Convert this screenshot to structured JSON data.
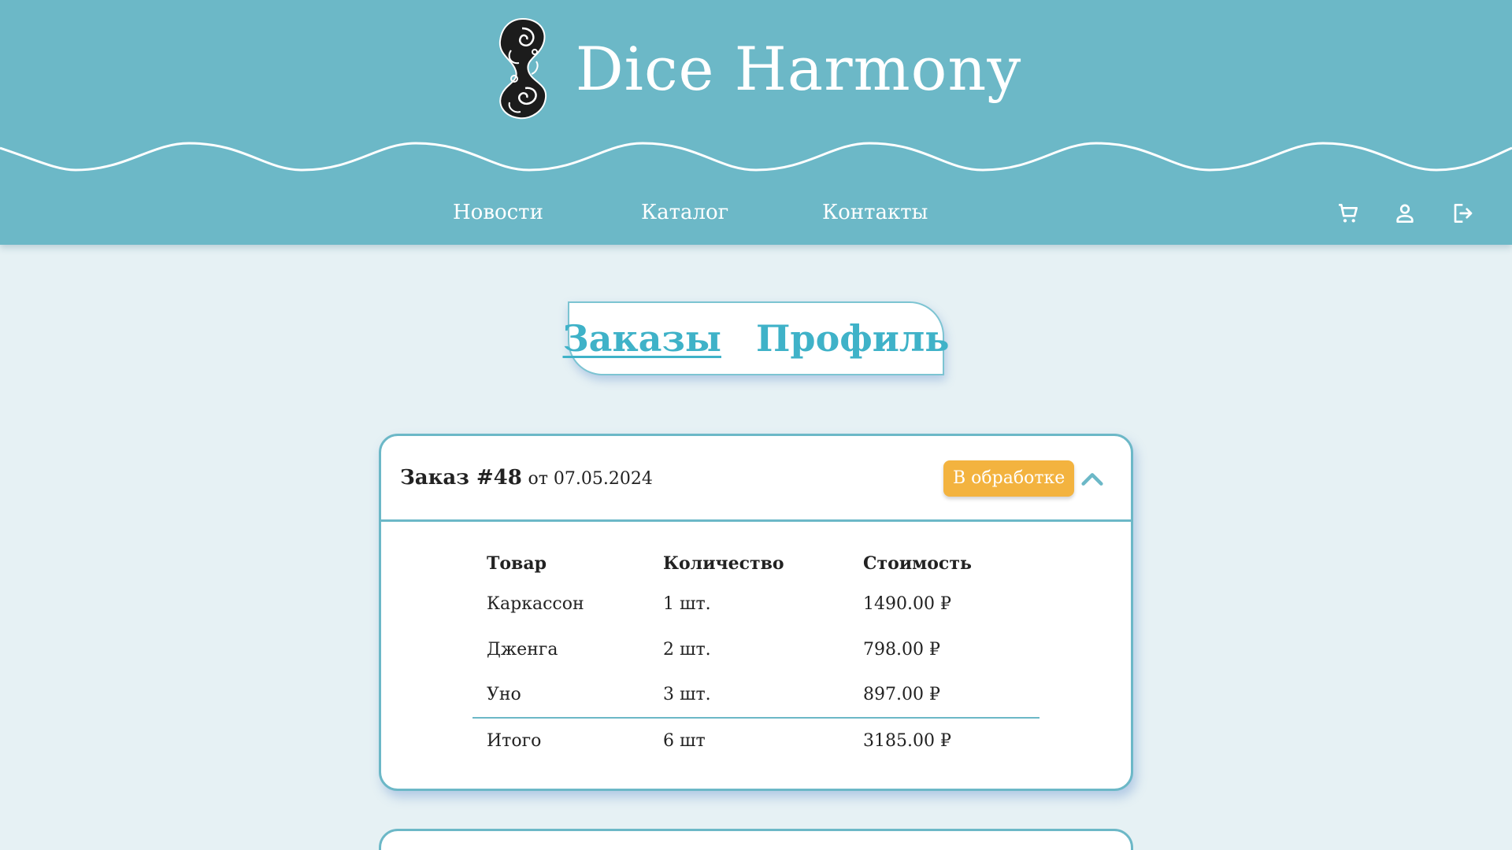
{
  "brand": {
    "title": "Dice Harmony",
    "logo_icon": "swirl-logo-icon"
  },
  "nav": {
    "links": [
      {
        "label": "Новости"
      },
      {
        "label": "Каталог"
      },
      {
        "label": "Контакты"
      }
    ],
    "icons": [
      "cart-icon",
      "user-icon",
      "logout-icon"
    ]
  },
  "tabs": [
    {
      "label": "Заказы",
      "active": true
    },
    {
      "label": "Профиль",
      "active": false
    }
  ],
  "order": {
    "number": "Заказ #48",
    "date": "от 07.05.2024",
    "status": "В обработке",
    "status_color": "#f3b33f",
    "headers": [
      "Товар",
      "Количество",
      "Стоимость"
    ],
    "rows": [
      [
        "Каркассон",
        "1 шт.",
        "1490.00 ₽"
      ],
      [
        "Дженга",
        "2 шт.",
        "798.00 ₽"
      ],
      [
        "Уно",
        "3 шт.",
        "897.00 ₽"
      ]
    ],
    "total": [
      "Итого",
      "6 шт",
      "3185.00 ₽"
    ]
  },
  "colors": {
    "header": "#6cb8c7",
    "accent": "#3fb2c8",
    "background": "#e6f1f4"
  }
}
